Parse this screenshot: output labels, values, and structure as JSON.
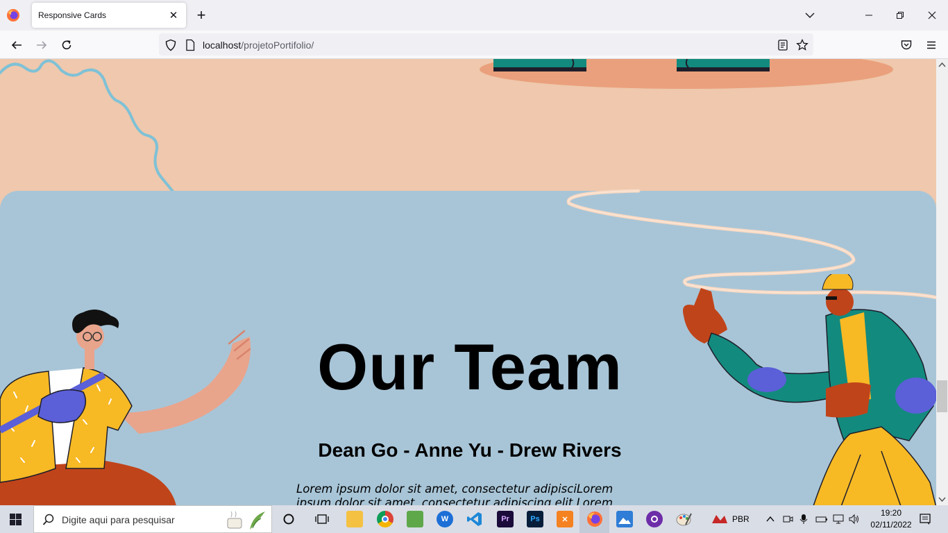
{
  "browser": {
    "tab_title": "Responsive Cards",
    "url_host": "localhost",
    "url_path": "/projetoPortifolio/"
  },
  "page": {
    "title": "Our Team",
    "names": "Dean Go - Anne Yu - Drew Rivers",
    "lorem": "Lorem ipsum dolor sit amet, consectetur adipisciLorem ipsum dolor sit amet, consectetur adipiscing elit Lorem ipsum dolor"
  },
  "taskbar": {
    "search_placeholder": "Digite aqui para pesquisar",
    "language": "PBR",
    "time": "19:20",
    "date": "02/11/2022",
    "apps": [
      "start-icon",
      "cortana-icon",
      "task-view-icon",
      "file-explorer-icon",
      "chrome-icon",
      "notepad-icon",
      "word-icon",
      "vscode-icon",
      "premiere-icon",
      "photoshop-icon",
      "xampp-icon",
      "firefox-icon",
      "photos-icon",
      "github-icon",
      "paint-icon",
      "ruby-icon"
    ]
  },
  "colors": {
    "page_bg": "#efc8ad",
    "team_bg": "#a8c5d7",
    "accent_teal": "#138a7e",
    "accent_yellow": "#f7b924"
  }
}
